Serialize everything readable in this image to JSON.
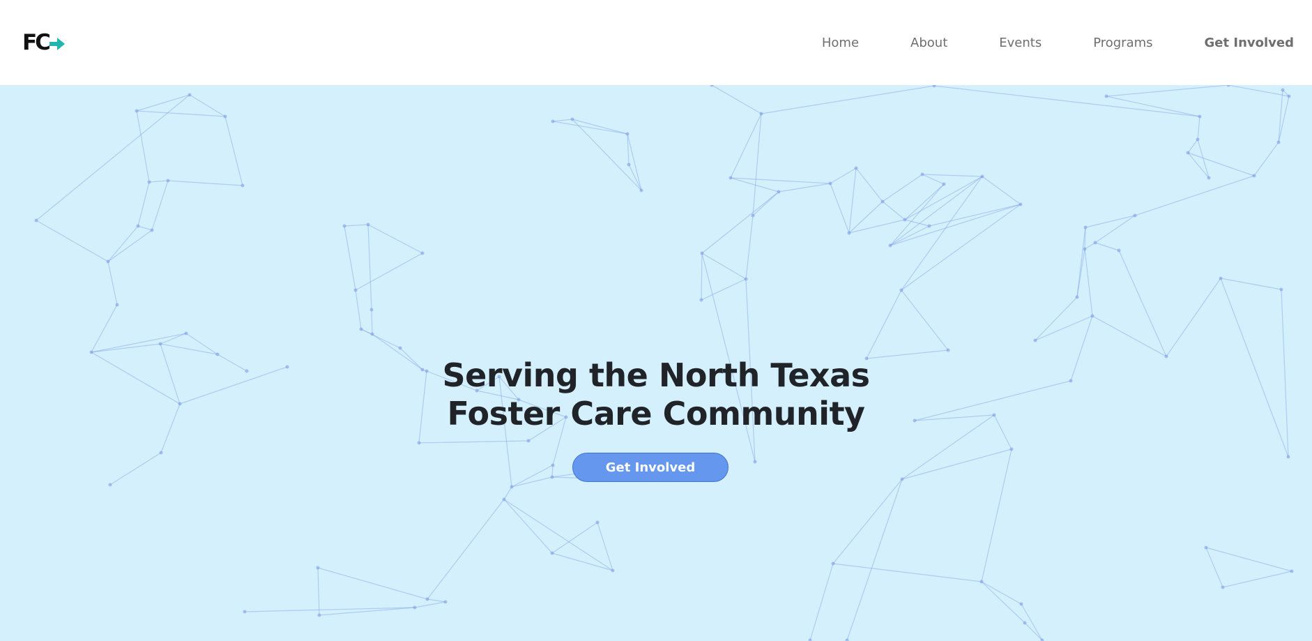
{
  "header": {
    "logo": {
      "text": "FC",
      "arrow_color": "#21b5b0"
    },
    "nav": [
      {
        "label": "Home"
      },
      {
        "label": "About"
      },
      {
        "label": "Events"
      },
      {
        "label": "Programs"
      },
      {
        "label": "Get Involved"
      }
    ]
  },
  "hero": {
    "background_color": "#d4f0fc",
    "title_line1": "Serving the North Texas",
    "title_line2": "Foster Care Community",
    "cta_label": "Get Involved",
    "cta_color": "#6597ee",
    "network_color": "#7f9fe8"
  }
}
